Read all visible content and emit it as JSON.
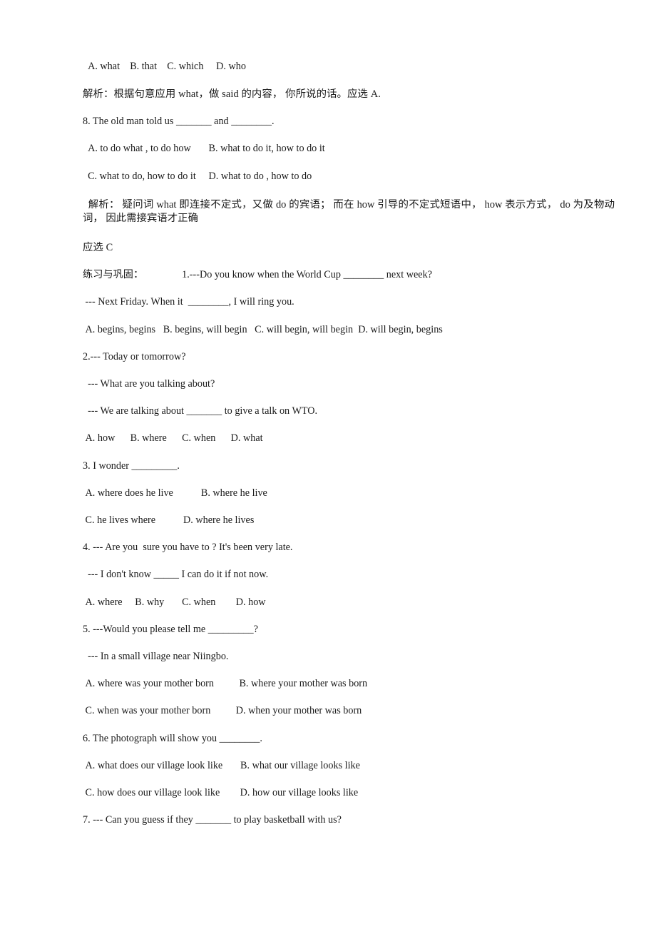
{
  "document": {
    "type": "exam-worksheet",
    "language": "zh-CN + en",
    "background_color": "#ffffff",
    "text_color": "#1a1a1a"
  },
  "lines": {
    "q7_options": "  A. what    B. that    C. which     D. who",
    "q7_explanation": "解析：根据句意应用 what，做 said 的内容， 你所说的话。应选 A.",
    "q8_stem": "8. The old man told us _______ and ________.",
    "q8_options_ab": "  A. to do what , to do how       B. what to do it, how to do it",
    "q8_options_cd": "  C. what to do, how to do it     D. what to do , how to do",
    "q8_explanation": "  解析： 疑问词 what 即连接不定式，又做 do 的宾语； 而在 how 引导的不定式短语中， how 表示方式， do 为及物动词， 因此需接宾语才正确",
    "q8_answer": "应选 C",
    "practice_heading": "练习与巩固：",
    "p1_stem": "1.---Do you know when the World Cup ________ next week?",
    "p1_reply": " --- Next Friday. When it  ________, I will ring you.",
    "p1_options": " A. begins, begins   B. begins, will begin   C. will begin, will begin  D. will begin, begins",
    "p2_stem": "2.--- Today or tomorrow?",
    "p2_line2": "  --- What are you talking about?",
    "p2_line3": "  --- We are talking about _______ to give a talk on WTO.",
    "p2_options": " A. how      B. where      C. when      D. what",
    "p3_stem": "3. I wonder _________.",
    "p3_options_ab": " A. where does he live           B. where he live",
    "p3_options_cd": " C. he lives where           D. where he lives",
    "p4_stem": "4. --- Are you  sure you have to ? It's been very late.",
    "p4_reply": "  --- I don't know _____ I can do it if not now.",
    "p4_options": " A. where     B. why       C. when        D. how",
    "p5_stem": "5. ---Would you please tell me _________?",
    "p5_reply": "  --- In a small village near Niingbo.",
    "p5_options_ab": " A. where was your mother born          B. where your mother was born",
    "p5_options_cd": " C. when was your mother born          D. when your mother was born",
    "p6_stem": "6. The photograph will show you ________.",
    "p6_options_ab": " A. what does our village look like       B. what our village looks like",
    "p6_options_cd": " C. how does our village look like        D. how our village looks like",
    "p7_stem": "7. --- Can you guess if they _______ to play basketball with us?"
  }
}
